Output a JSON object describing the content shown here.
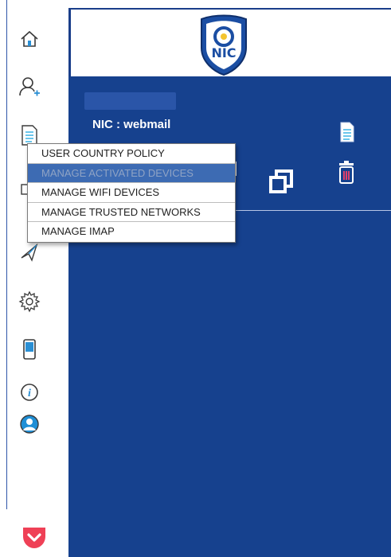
{
  "sidebar": {
    "icons": [
      "home-icon",
      "add-user-icon",
      "document-list-icon",
      "device-icon",
      "send-icon",
      "settings-icon",
      "phone-icon",
      "info-icon",
      "user-circle-icon"
    ]
  },
  "header": {
    "logo_text": "NIC"
  },
  "account": {
    "label": "NIC : webmail"
  },
  "menu": {
    "items": [
      "USER COUNTRY POLICY",
      "MANAGE ACTIVATED DEVICES",
      "MANAGE WIFI DEVICES",
      "MANAGE TRUSTED NETWORKS",
      "MANAGE IMAP"
    ],
    "active_index": 1
  },
  "colors": {
    "panel": "#16418e",
    "accent": "#3ab4e6",
    "pocket": "#ef4056"
  }
}
